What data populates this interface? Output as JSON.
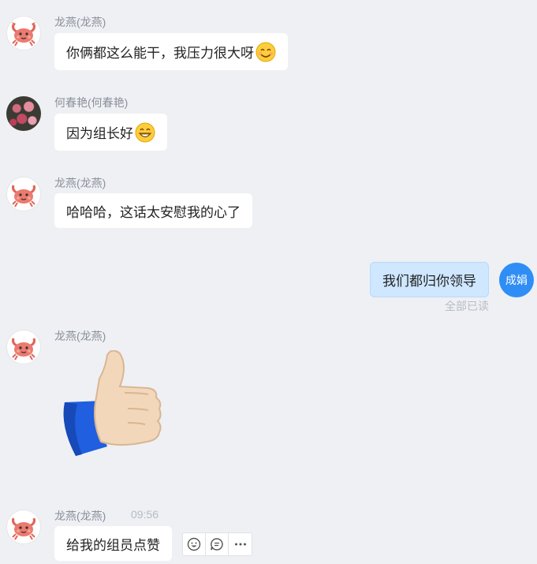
{
  "messages": [
    {
      "sender": "龙燕(龙燕)",
      "text": "你俩都这么能干，我压力很大呀"
    },
    {
      "sender": "何春艳(何春艳)",
      "text": "因为组长好"
    },
    {
      "sender": "龙燕(龙燕)",
      "text": "哈哈哈，这话太安慰我的心了"
    },
    {
      "sender": "成娟",
      "text": "我们都归你领导",
      "status": "全部已读"
    },
    {
      "sender": "龙燕(龙燕)",
      "sticker": "thumbs-up"
    },
    {
      "sender": "龙燕(龙燕)",
      "time": "09:56",
      "text": "给我的组员点赞"
    }
  ],
  "my_avatar_label": "成娟",
  "colors": {
    "background": "#eef0f4",
    "my_bubble": "#cfe7ff",
    "my_avatar": "#2f8ef5",
    "other_bubble": "#ffffff"
  },
  "message_actions": [
    "emoji-reaction-icon",
    "reply-icon",
    "more-icon"
  ]
}
